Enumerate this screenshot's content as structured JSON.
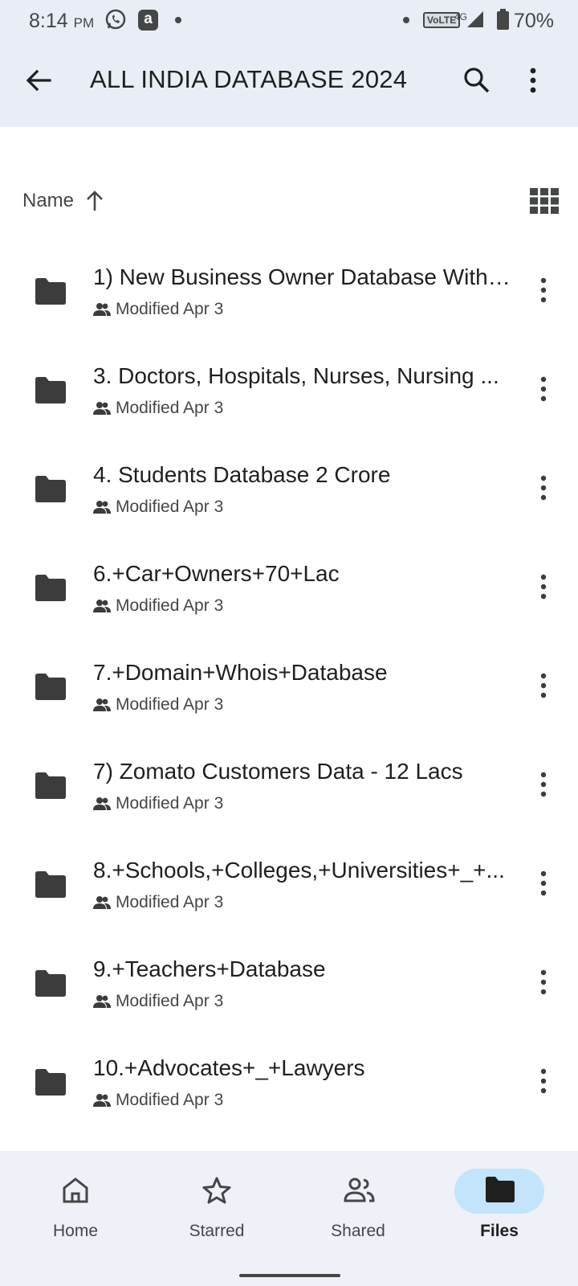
{
  "status_bar": {
    "time": "8:14",
    "ampm": "PM",
    "network_badge": "VoLTE",
    "network_type": "4G",
    "battery": "70%"
  },
  "app_bar": {
    "title": "ALL INDIA DATABASE 2024",
    "icons": [
      "back-arrow-icon",
      "search-icon",
      "more-vert-icon"
    ]
  },
  "sort": {
    "label": "Name",
    "direction": "ascending"
  },
  "files": [
    {
      "name": "1) New Business Owner Database With ...",
      "modified": "Modified Apr 3",
      "shared": true
    },
    {
      "name": "3. Doctors, Hospitals, Nurses, Nursing ...",
      "modified": "Modified Apr 3",
      "shared": true
    },
    {
      "name": "4. Students Database 2 Crore",
      "modified": "Modified Apr 3",
      "shared": true
    },
    {
      "name": "6.+Car+Owners+70+Lac",
      "modified": "Modified Apr 3",
      "shared": true
    },
    {
      "name": "7.+Domain+Whois+Database",
      "modified": "Modified Apr 3",
      "shared": true
    },
    {
      "name": "7) Zomato Customers Data - 12 Lacs",
      "modified": "Modified Apr 3",
      "shared": true
    },
    {
      "name": "8.+Schools,+Colleges,+Universities+_+...",
      "modified": "Modified Apr 3",
      "shared": true
    },
    {
      "name": "9.+Teachers+Database",
      "modified": "Modified Apr 3",
      "shared": true
    },
    {
      "name": "10.+Advocates+_+Lawyers",
      "modified": "Modified Apr 3",
      "shared": true
    }
  ],
  "bottom_nav": [
    {
      "label": "Home",
      "icon": "home-icon",
      "active": false
    },
    {
      "label": "Starred",
      "icon": "star-icon",
      "active": false
    },
    {
      "label": "Shared",
      "icon": "shared-icon",
      "active": false
    },
    {
      "label": "Files",
      "icon": "folder-icon",
      "active": true
    }
  ],
  "colors": {
    "app_bar_bg": "#e9edf6",
    "active_pill": "#c4e4fb",
    "nav_bg": "#eef1f8"
  }
}
